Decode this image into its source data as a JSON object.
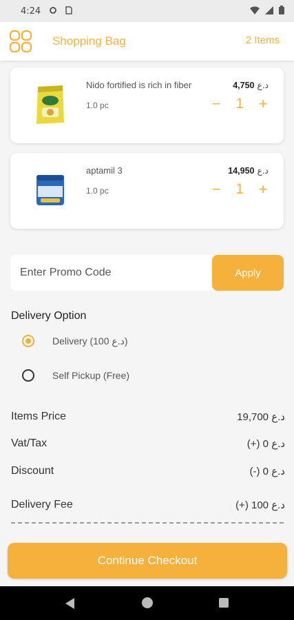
{
  "status_bar": {
    "time": "4:24",
    "icons": [
      "settings-icon",
      "sim-icon",
      "wifi-icon",
      "signal-icon",
      "battery-icon"
    ]
  },
  "header": {
    "title": "Shopping Bag",
    "item_count": "2 Items",
    "menu_icon": "grid-menu-icon"
  },
  "cart": {
    "items": [
      {
        "name": "Nido fortified is rich in fiber",
        "unit": "1.0 pc",
        "price": "4,750",
        "currency": "د.ع",
        "quantity": "1",
        "image_icon": "milk-powder-pack"
      },
      {
        "name": "aptamil 3",
        "unit": "1.0 pc",
        "price": "14,950",
        "currency": "د.ع",
        "quantity": "1",
        "image_icon": "formula-tin"
      }
    ],
    "decrement_symbol": "−",
    "increment_symbol": "+"
  },
  "promo": {
    "placeholder": "Enter Promo Code",
    "value": "",
    "apply_label": "Apply"
  },
  "delivery": {
    "heading": "Delivery Option",
    "options": [
      {
        "label": "Delivery (100 د.ع)",
        "selected": true
      },
      {
        "label": "Self Pickup (Free)",
        "selected": false
      }
    ]
  },
  "summary": {
    "items_price_label": "Items Price",
    "items_price_value": "19,700 د.ع",
    "vat_label": "Vat/Tax",
    "vat_value": "(+) 0 د.ع",
    "discount_label": "Discount",
    "discount_value": "(-) 0 د.ع",
    "delivery_fee_label": "Delivery Fee",
    "delivery_fee_value": "(+) 100 د.ع"
  },
  "checkout": {
    "label": "Continue Checkout"
  },
  "colors": {
    "accent": "#f6b03c",
    "background": "#f5f5f5",
    "card": "#ffffff",
    "nav_bar": "#000000"
  }
}
